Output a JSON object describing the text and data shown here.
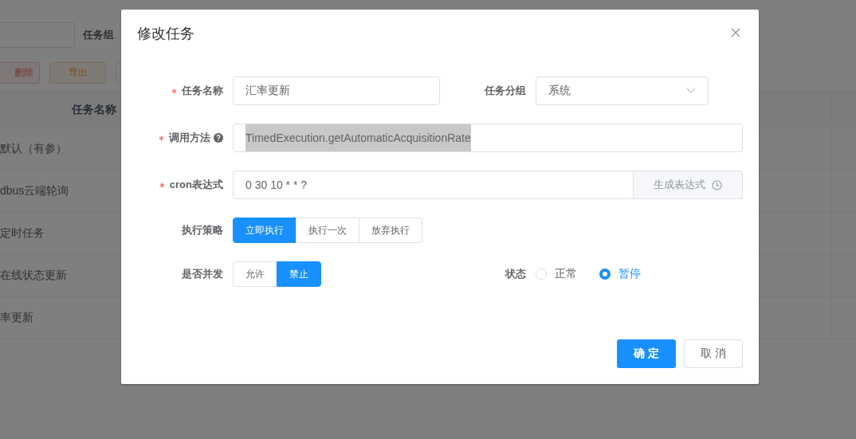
{
  "background": {
    "filter_label": "任务组",
    "toolbar": [
      {
        "label": "删除",
        "kind": "danger"
      },
      {
        "label": "导出",
        "kind": "warning"
      }
    ],
    "table": {
      "columns": [
        "任务名称"
      ],
      "rows": [
        "默认（有参）",
        "dbus云端轮询",
        "定时任务",
        "在线状态更新",
        "率更新"
      ]
    }
  },
  "dialog": {
    "title": "修改任务",
    "name": {
      "label": "任务名称",
      "required": true,
      "value": "汇率更新"
    },
    "group": {
      "label": "任务分组",
      "value": "系统"
    },
    "method": {
      "label": "调用方法",
      "required": true,
      "value": "TimedExecution.getAutomaticAcquisitionRate",
      "highlighted": true
    },
    "cron": {
      "label": "cron表达式",
      "required": true,
      "value": "0 30 10 * * ?",
      "button": "生成表达式"
    },
    "strategy": {
      "label": "执行策略",
      "options": [
        {
          "label": "立即执行",
          "selected": true
        },
        {
          "label": "执行一次",
          "selected": false
        },
        {
          "label": "放弃执行",
          "selected": false
        }
      ]
    },
    "concurrent": {
      "label": "是否并发",
      "options": [
        {
          "label": "允许",
          "selected": false
        },
        {
          "label": "禁止",
          "selected": true
        }
      ]
    },
    "status": {
      "label": "状态",
      "options": [
        {
          "label": "正常",
          "selected": false
        },
        {
          "label": "暂停",
          "selected": true
        }
      ]
    },
    "buttons": [
      {
        "label": "确 定",
        "kind": "primary"
      },
      {
        "label": "取 消",
        "kind": "default"
      }
    ]
  }
}
